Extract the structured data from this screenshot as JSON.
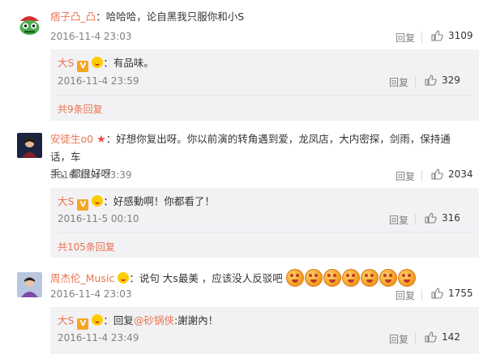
{
  "comments": [
    {
      "user": "痞子凸_凸",
      "text": "哈哈哈，论自黑我只服你和小S",
      "time": "2016-11-4 23:03",
      "reply_label": "回复",
      "likes": "3109",
      "replies": [
        {
          "user": "大S",
          "text": "有品味。",
          "time": "2016-11-4 23:59",
          "reply_label": "回复",
          "likes": "329"
        }
      ],
      "more": "共9条回复"
    },
    {
      "user": "安徒生o0",
      "text_line1": "好想你复出呀。你以前演的转角遇到爱，龙凤店，大内密探，剑雨，保持通话，车",
      "text_line2": "手，都很好呀",
      "time": "2016-11-4 23:39",
      "reply_label": "回复",
      "likes": "2034",
      "replies": [
        {
          "user": "大S",
          "text": "好感動啊！你都看了！",
          "time": "2016-11-5 00:10",
          "reply_label": "回复",
          "likes": "316"
        }
      ],
      "more": "共105条回复"
    },
    {
      "user": "周杰伦_Music",
      "text": "说句   大s最美 ，应该没人反驳吧",
      "time": "2016-11-4 23:03",
      "reply_label": "回复",
      "likes": "1755",
      "replies": [
        {
          "user": "大S",
          "prefix": "回复",
          "mention": "@砂锅侠",
          "text": "謝謝內！",
          "time": "2016-11-4 23:49",
          "reply_label": "回复",
          "likes": "142"
        }
      ]
    }
  ],
  "colors": {
    "username": "#eb7350",
    "meta": "#808080",
    "reply_bg": "#f2f2f5"
  },
  "icons": {
    "like": "thumbs-up-icon",
    "verified": "verified-v-icon",
    "vip": "vip-emoji-icon",
    "star": "star-icon"
  }
}
